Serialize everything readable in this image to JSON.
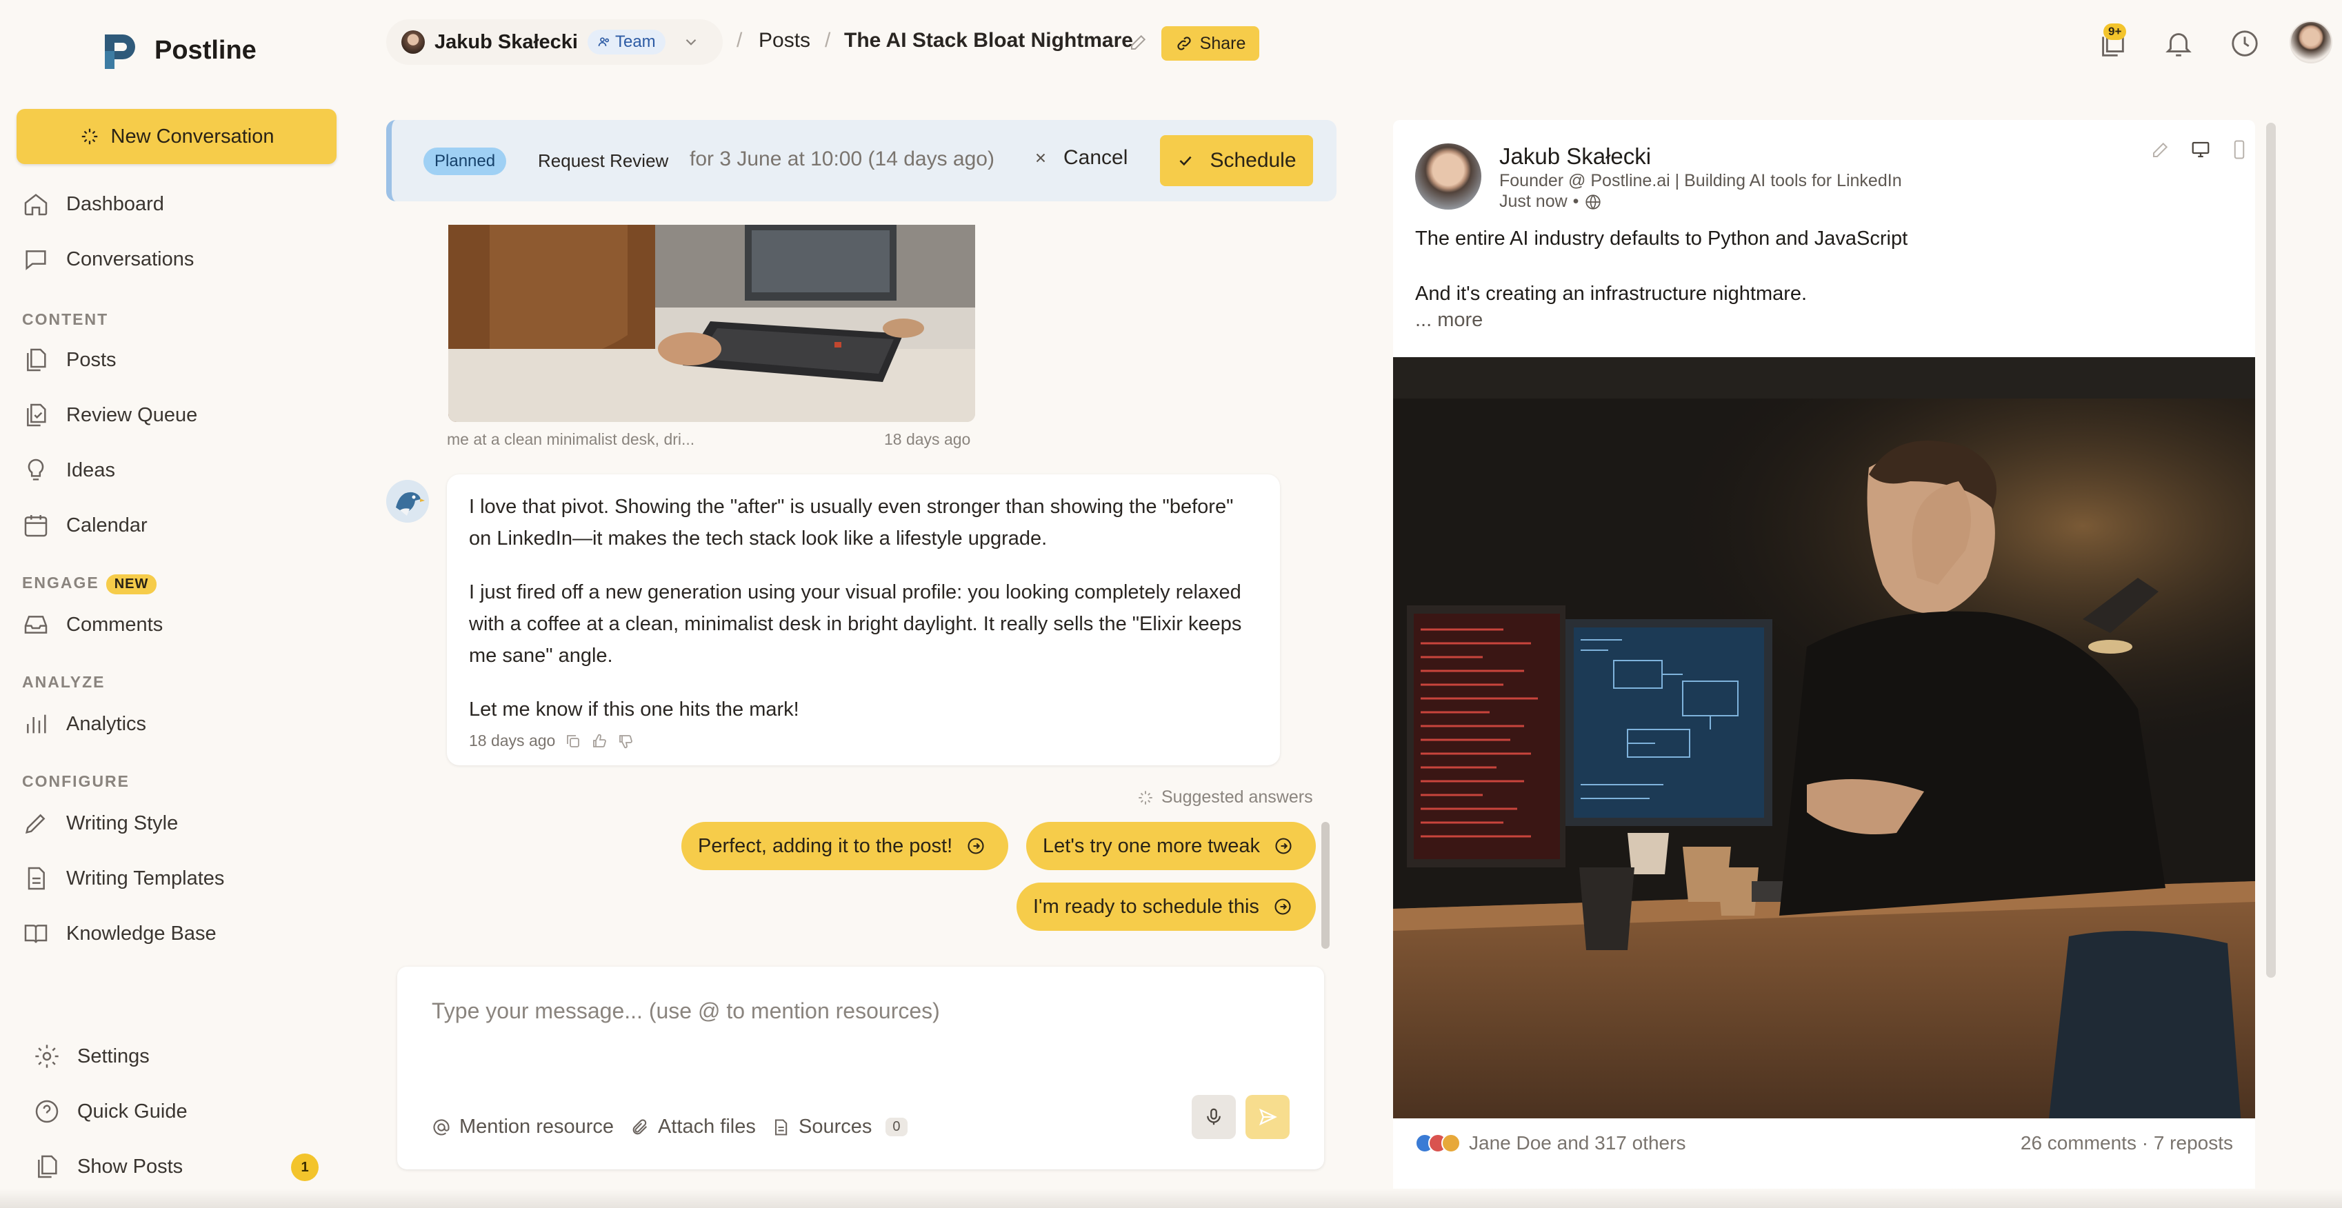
{
  "app": {
    "name": "Postline"
  },
  "sidebar": {
    "new_conversation": "New Conversation",
    "items": {
      "dashboard": "Dashboard",
      "conversations": "Conversations",
      "posts": "Posts",
      "review_queue": "Review Queue",
      "ideas": "Ideas",
      "calendar": "Calendar",
      "comments": "Comments",
      "analytics": "Analytics",
      "writing_style": "Writing Style",
      "writing_templates": "Writing Templates",
      "knowledge_base": "Knowledge Base",
      "settings": "Settings",
      "quick_guide": "Quick Guide",
      "show_posts": "Show Posts"
    },
    "sections": {
      "content": "CONTENT",
      "engage": "ENGAGE",
      "analyze": "ANALYZE",
      "configure": "CONFIGURE"
    },
    "engage_badge": "NEW",
    "show_posts_count": "1"
  },
  "header": {
    "user_name": "Jakub Skałecki",
    "team_label": "Team",
    "breadcrumb_sep": "/",
    "crumb_posts": "Posts",
    "post_title": "The AI Stack Bloat Nightmare",
    "share_label": "Share",
    "notification_count": "9+"
  },
  "schedule": {
    "status": "Planned",
    "request_review": "Request Review",
    "date_text": "for 3 June at 10:00 (14 days ago)",
    "cancel": "Cancel",
    "schedule": "Schedule"
  },
  "chat": {
    "image_caption": "me at a clean minimalist desk, dri...",
    "image_time": "18 days ago",
    "message": {
      "p1": "I love that pivot. Showing the \"after\" is usually even stronger than showing the \"before\" on LinkedIn—it makes the tech stack look like a lifestyle upgrade.",
      "p2": "I just fired off a new generation using your visual profile: you looking completely relaxed with a coffee at a clean, minimalist desk in bright daylight. It really sells the \"Elixir keeps me sane\" angle.",
      "p3": "Let me know if this one hits the mark!",
      "time": "18 days ago"
    },
    "suggested_header": "Suggested answers",
    "suggestions": [
      "Perfect, adding it to the post!",
      "Let's try one more tweak",
      "I'm ready to schedule this"
    ],
    "input_placeholder": "Type your message... (use @ to mention resources)",
    "mention_resource": "Mention resource",
    "attach_files": "Attach files",
    "sources": "Sources",
    "sources_count": "0"
  },
  "preview": {
    "author": "Jakub Skałecki",
    "headline": "Founder @ Postline.ai | Building AI tools for LinkedIn",
    "time": "Just now",
    "time_sep": "•",
    "line1": "The entire AI industry defaults to Python and JavaScript",
    "line2": "And it's creating an infrastructure nightmare.",
    "more": "... more",
    "reactions": "Jane Doe and 317 others",
    "stats": "26 comments · 7 reposts"
  },
  "colors": {
    "accent": "#f6cc4a",
    "planned": "#9fd0f4",
    "background": "#fbf8f4"
  }
}
